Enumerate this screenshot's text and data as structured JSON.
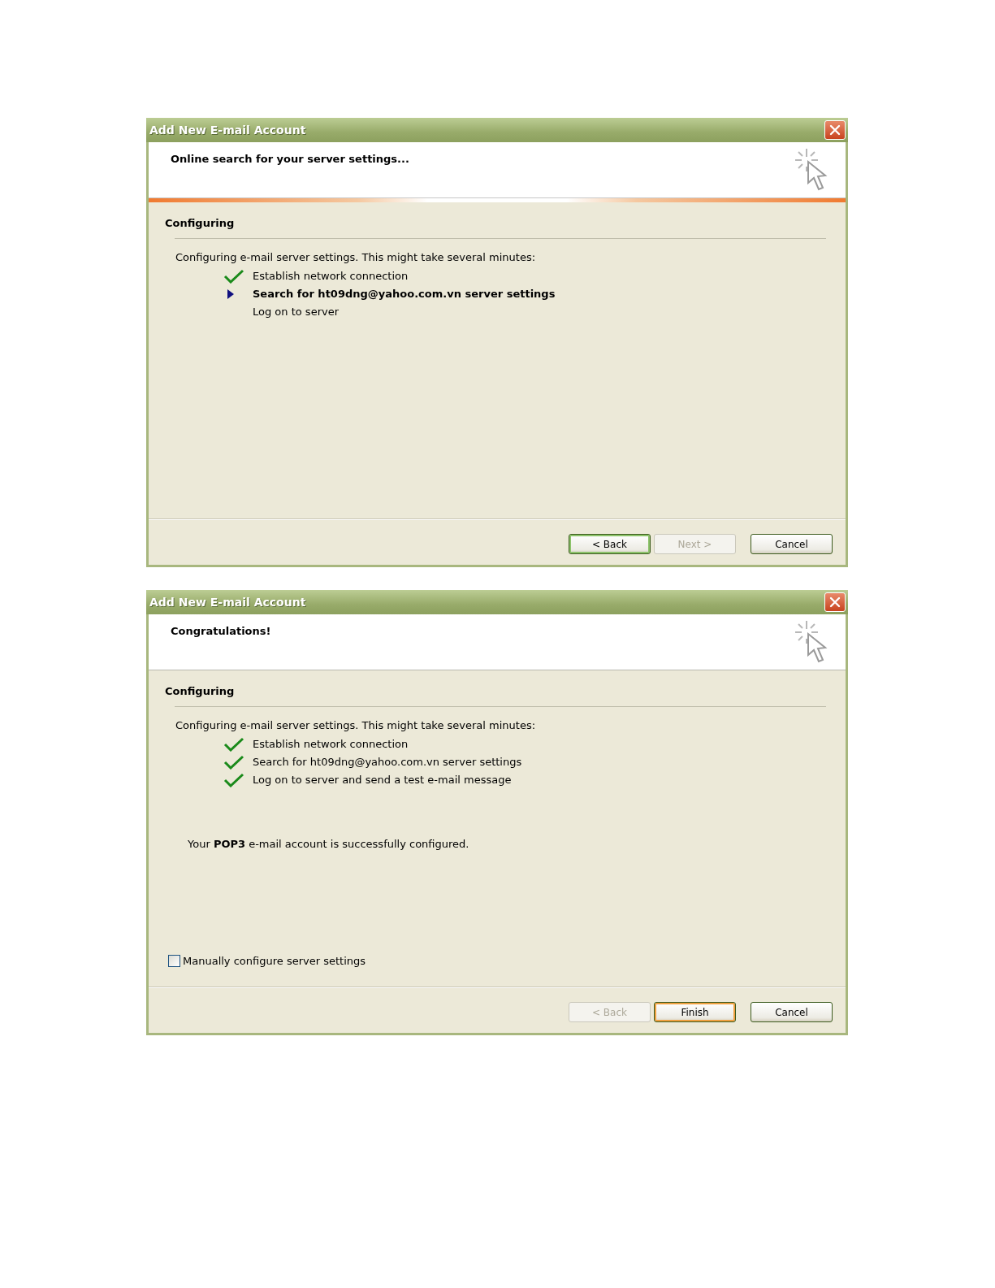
{
  "dialogs": [
    {
      "title": "Add New E-mail Account",
      "header": "Online search for your server settings...",
      "progress_band": true,
      "section": "Configuring",
      "intro": "Configuring e-mail server settings. This might take several minutes:",
      "steps": [
        {
          "text": "Establish network connection",
          "done": true,
          "current": false
        },
        {
          "text": "Search for ht09dng@yahoo.com.vn server settings",
          "done": false,
          "current": true
        },
        {
          "text": "Log on to server",
          "done": false,
          "current": false
        }
      ],
      "buttons": [
        {
          "label": "< Back",
          "disabled": false,
          "focused": true,
          "hovered": false
        },
        {
          "label": "Next >",
          "disabled": true,
          "focused": false,
          "hovered": false
        },
        {
          "label": "Cancel",
          "disabled": false,
          "focused": false,
          "hovered": false
        }
      ]
    },
    {
      "title": "Add New E-mail Account",
      "header": "Congratulations!",
      "progress_band": false,
      "section": "Configuring",
      "intro": "Configuring e-mail server settings. This might take several minutes:",
      "steps": [
        {
          "text": "Establish network connection",
          "done": true,
          "current": false
        },
        {
          "text": "Search for ht09dng@yahoo.com.vn server settings",
          "done": true,
          "current": false
        },
        {
          "text": "Log on to server and send a test e-mail message",
          "done": true,
          "current": false
        }
      ],
      "message": "Your **POP3** e-mail account is successfully configured.",
      "checkbox": {
        "label": "Manually configure server settings",
        "checked": false
      },
      "buttons": [
        {
          "label": "< Back",
          "disabled": true,
          "focused": false,
          "hovered": false
        },
        {
          "label": "Finish",
          "disabled": false,
          "focused": false,
          "hovered": true
        },
        {
          "label": "Cancel",
          "disabled": false,
          "focused": false,
          "hovered": false
        }
      ]
    }
  ]
}
